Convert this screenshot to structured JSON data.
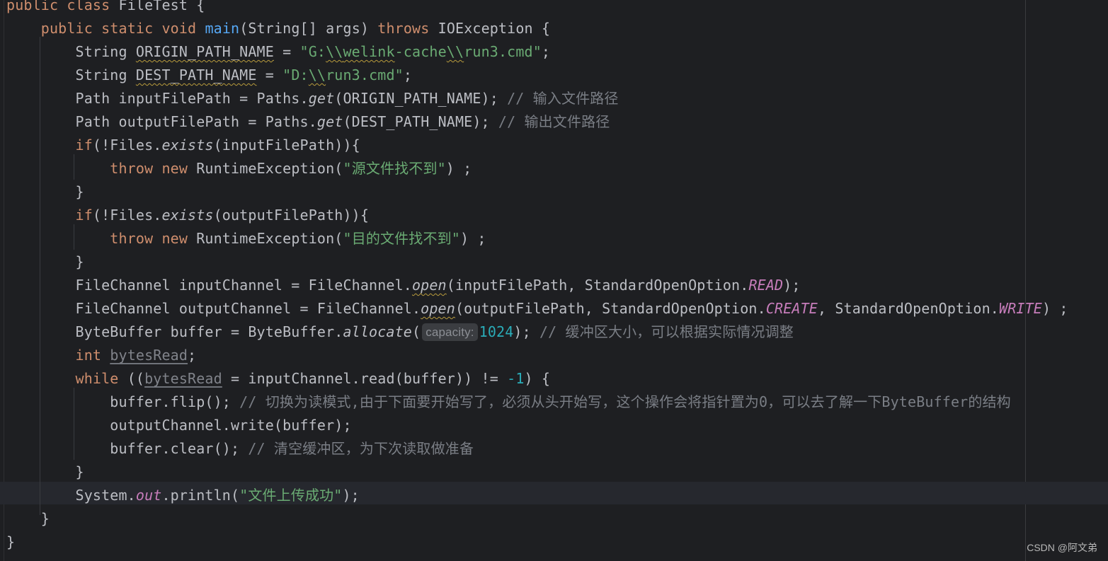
{
  "editor": {
    "watermark": "CSDN @阿文弟",
    "lines": [
      {
        "segments": [
          {
            "t": "public",
            "c": "kw"
          },
          {
            "t": " "
          },
          {
            "t": "class",
            "c": "kw"
          },
          {
            "t": " FileTest {"
          }
        ]
      },
      {
        "segments": [
          {
            "t": "    "
          },
          {
            "t": "public",
            "c": "kw"
          },
          {
            "t": " "
          },
          {
            "t": "static",
            "c": "kw"
          },
          {
            "t": " "
          },
          {
            "t": "void",
            "c": "kw"
          },
          {
            "t": " "
          },
          {
            "t": "main",
            "c": "fn"
          },
          {
            "t": "(String[] args) "
          },
          {
            "t": "throws",
            "c": "kw"
          },
          {
            "t": " IOException {"
          }
        ]
      },
      {
        "segments": [
          {
            "t": "        String "
          },
          {
            "t": "ORIGIN_PATH_NAME",
            "c": "warn"
          },
          {
            "t": " = "
          },
          {
            "t": "\"G:",
            "c": "str"
          },
          {
            "t": "\\\\",
            "c": "str warn"
          },
          {
            "t": "welink",
            "c": "str warn"
          },
          {
            "t": "-cache",
            "c": "str"
          },
          {
            "t": "\\\\",
            "c": "str warn"
          },
          {
            "t": "run3.cmd\"",
            "c": "str"
          },
          {
            "t": ";"
          }
        ]
      },
      {
        "segments": [
          {
            "t": "        String "
          },
          {
            "t": "DEST_PATH_NAME",
            "c": "warn"
          },
          {
            "t": " = "
          },
          {
            "t": "\"D:",
            "c": "str"
          },
          {
            "t": "\\\\",
            "c": "str warn"
          },
          {
            "t": "run3.cmd\"",
            "c": "str"
          },
          {
            "t": ";"
          }
        ]
      },
      {
        "segments": [
          {
            "t": "        Path inputFilePath = Paths."
          },
          {
            "t": "get",
            "c": "italic"
          },
          {
            "t": "(ORIGIN_PATH_NAME); "
          },
          {
            "t": "// 输入文件路径",
            "c": "cmt"
          }
        ]
      },
      {
        "segments": [
          {
            "t": "        Path outputFilePath = Paths."
          },
          {
            "t": "get",
            "c": "italic"
          },
          {
            "t": "(DEST_PATH_NAME); "
          },
          {
            "t": "// 输出文件路径",
            "c": "cmt"
          }
        ]
      },
      {
        "segments": [
          {
            "t": "        "
          },
          {
            "t": "if",
            "c": "kw"
          },
          {
            "t": "(!Files."
          },
          {
            "t": "exists",
            "c": "italic"
          },
          {
            "t": "(inputFilePath)){"
          }
        ]
      },
      {
        "segments": [
          {
            "t": "            "
          },
          {
            "t": "throw",
            "c": "kw"
          },
          {
            "t": " "
          },
          {
            "t": "new",
            "c": "kw"
          },
          {
            "t": " RuntimeException("
          },
          {
            "t": "\"源文件找不到\"",
            "c": "str"
          },
          {
            "t": ") ;"
          }
        ]
      },
      {
        "segments": [
          {
            "t": "        }"
          }
        ]
      },
      {
        "segments": [
          {
            "t": "        "
          },
          {
            "t": "if",
            "c": "kw"
          },
          {
            "t": "(!Files."
          },
          {
            "t": "exists",
            "c": "italic"
          },
          {
            "t": "(outputFilePath)){"
          }
        ]
      },
      {
        "segments": [
          {
            "t": "            "
          },
          {
            "t": "throw",
            "c": "kw"
          },
          {
            "t": " "
          },
          {
            "t": "new",
            "c": "kw"
          },
          {
            "t": " RuntimeException("
          },
          {
            "t": "\"目的文件找不到\"",
            "c": "str"
          },
          {
            "t": ") ;"
          }
        ]
      },
      {
        "segments": [
          {
            "t": "        }"
          }
        ]
      },
      {
        "segments": [
          {
            "t": "        FileChannel inputChannel = FileChannel."
          },
          {
            "t": "open",
            "c": "italic warn"
          },
          {
            "t": "(inputFilePath, StandardOpenOption."
          },
          {
            "t": "READ",
            "c": "field"
          },
          {
            "t": ");"
          }
        ]
      },
      {
        "segments": [
          {
            "t": "        FileChannel outputChannel = FileChannel."
          },
          {
            "t": "open",
            "c": "italic warn"
          },
          {
            "t": "(outputFilePath, StandardOpenOption."
          },
          {
            "t": "CREATE",
            "c": "field"
          },
          {
            "t": ", StandardOpenOption."
          },
          {
            "t": "WRITE",
            "c": "field"
          },
          {
            "t": ") ;"
          }
        ]
      },
      {
        "segments": [
          {
            "t": "        ByteBuffer buffer = ByteBuffer."
          },
          {
            "t": "allocate",
            "c": "italic"
          },
          {
            "t": "("
          },
          {
            "t": "capacity:",
            "c": "hint"
          },
          {
            "t": "1024",
            "c": "num"
          },
          {
            "t": "); "
          },
          {
            "t": "// 缓冲区大小，可以根据实际情况调整",
            "c": "cmt"
          }
        ]
      },
      {
        "segments": [
          {
            "t": "        "
          },
          {
            "t": "int",
            "c": "kw"
          },
          {
            "t": " "
          },
          {
            "t": "bytesRead",
            "c": "unused"
          },
          {
            "t": ";"
          }
        ]
      },
      {
        "segments": [
          {
            "t": "        "
          },
          {
            "t": "while",
            "c": "kw"
          },
          {
            "t": " (("
          },
          {
            "t": "bytesRead",
            "c": "unused"
          },
          {
            "t": " = inputChannel.read(buffer)) != "
          },
          {
            "t": "-1",
            "c": "num"
          },
          {
            "t": ") {"
          }
        ]
      },
      {
        "segments": [
          {
            "t": "            buffer.flip(); "
          },
          {
            "t": "// 切换为读模式,由于下面要开始写了，必须从头开始写，这个操作会将指针置为0，可以去了解一下ByteBuffer的结构",
            "c": "cmt"
          }
        ]
      },
      {
        "segments": [
          {
            "t": "            outputChannel.write(buffer);"
          }
        ]
      },
      {
        "segments": [
          {
            "t": "            buffer.clear(); "
          },
          {
            "t": "// 清空缓冲区，为下次读取做准备",
            "c": "cmt"
          }
        ]
      },
      {
        "segments": [
          {
            "t": "        }"
          }
        ]
      },
      {
        "segments": [
          {
            "t": "        System."
          },
          {
            "t": "out",
            "c": "field"
          },
          {
            "t": ".println("
          },
          {
            "t": "\"文件上传成功\"",
            "c": "str"
          },
          {
            "t": ");"
          }
        ]
      },
      {
        "segments": [
          {
            "t": "    }"
          }
        ]
      },
      {
        "segments": [
          {
            "t": "}"
          }
        ]
      }
    ]
  }
}
